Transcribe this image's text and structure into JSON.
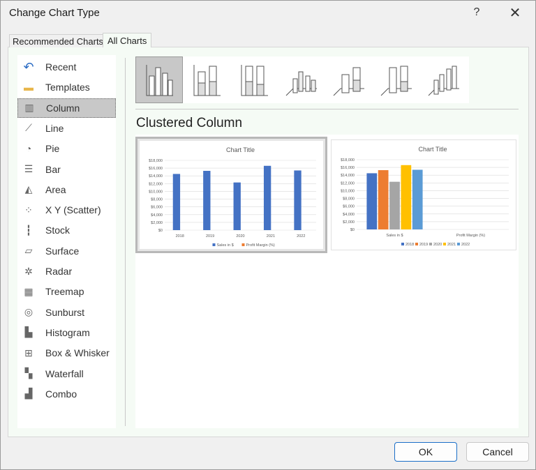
{
  "dialog": {
    "title": "Change Chart Type",
    "help": "?",
    "close": "✕"
  },
  "tabs": [
    {
      "label": "Recommended Charts"
    },
    {
      "label": "All Charts"
    }
  ],
  "sidebar": {
    "items": [
      {
        "label": "Recent",
        "icon": "recent-icon"
      },
      {
        "label": "Templates",
        "icon": "folder-icon"
      },
      {
        "label": "Column",
        "icon": "column-chart-icon",
        "selected": true
      },
      {
        "label": "Line",
        "icon": "line-chart-icon"
      },
      {
        "label": "Pie",
        "icon": "pie-chart-icon"
      },
      {
        "label": "Bar",
        "icon": "bar-chart-icon"
      },
      {
        "label": "Area",
        "icon": "area-chart-icon"
      },
      {
        "label": "X Y (Scatter)",
        "icon": "scatter-chart-icon"
      },
      {
        "label": "Stock",
        "icon": "stock-chart-icon"
      },
      {
        "label": "Surface",
        "icon": "surface-chart-icon"
      },
      {
        "label": "Radar",
        "icon": "radar-chart-icon"
      },
      {
        "label": "Treemap",
        "icon": "treemap-icon"
      },
      {
        "label": "Sunburst",
        "icon": "sunburst-icon"
      },
      {
        "label": "Histogram",
        "icon": "histogram-icon"
      },
      {
        "label": "Box & Whisker",
        "icon": "box-whisker-icon"
      },
      {
        "label": "Waterfall",
        "icon": "waterfall-icon"
      },
      {
        "label": "Combo",
        "icon": "combo-chart-icon"
      }
    ]
  },
  "subtype_title": "Clustered Column",
  "buttons": {
    "ok": "OK",
    "cancel": "Cancel"
  },
  "colors": {
    "blue": "#4472c4",
    "orange": "#ed7d31",
    "gray": "#a5a5a5",
    "yellow": "#ffc000",
    "lightblue": "#5b9bd5"
  },
  "chart_data": [
    {
      "type": "bar",
      "title": "Chart Title",
      "categories": [
        "2018",
        "2019",
        "2020",
        "2021",
        "2022"
      ],
      "series": [
        {
          "name": "Sales in $",
          "values": [
            14500,
            15300,
            12300,
            16600,
            15400
          ]
        },
        {
          "name": "Profit Margin (%)",
          "values": [
            0,
            0,
            0,
            0,
            0
          ]
        }
      ],
      "yticks": [
        "$0",
        "$2,000",
        "$4,000",
        "$6,000",
        "$8,000",
        "$10,000",
        "$12,000",
        "$14,000",
        "$16,000",
        "$18,000"
      ],
      "ylim": [
        0,
        18000
      ],
      "legend": "bottom"
    },
    {
      "type": "bar",
      "title": "Chart Title",
      "categories": [
        "Sales in $",
        "Profit Margin (%)"
      ],
      "series": [
        {
          "name": "2018",
          "values": [
            14500,
            0
          ]
        },
        {
          "name": "2019",
          "values": [
            15300,
            0
          ]
        },
        {
          "name": "2020",
          "values": [
            12300,
            0
          ]
        },
        {
          "name": "2021",
          "values": [
            16600,
            0
          ]
        },
        {
          "name": "2022",
          "values": [
            15400,
            0
          ]
        }
      ],
      "yticks": [
        "$0",
        "$2,000",
        "$4,000",
        "$6,000",
        "$8,000",
        "$10,000",
        "$12,000",
        "$14,000",
        "$16,000",
        "$18,000"
      ],
      "ylim": [
        0,
        18000
      ],
      "legend": "bottom"
    }
  ]
}
